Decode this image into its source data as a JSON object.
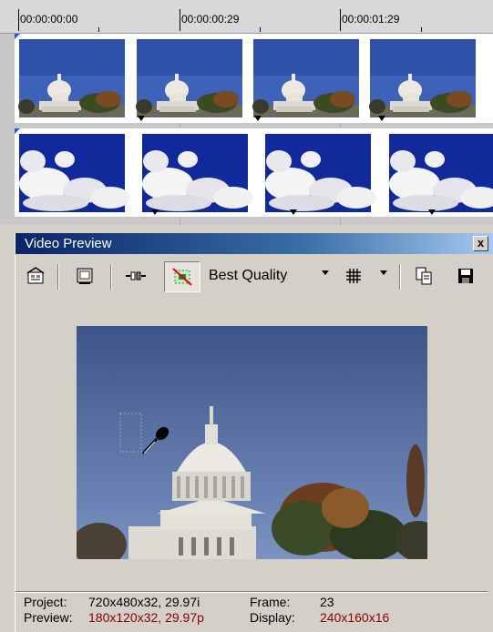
{
  "timeline": {
    "ruler_labels": [
      "00:00:00:00",
      "00:00:00:29",
      "00:00:01:29"
    ]
  },
  "video_preview": {
    "title": "Video Preview",
    "close_glyph": "x",
    "quality_label": "Best Quality",
    "icons": [
      "properties-icon",
      "preview-monitor-icon",
      "split-screen-icon",
      "overlays-icon",
      "grid-icon",
      "copy-snapshot-icon",
      "save-snapshot-icon",
      "eyedropper-icon"
    ]
  },
  "status": {
    "project_label": "Project:",
    "project_value": "720x480x32, 29.97i",
    "preview_label": "Preview:",
    "preview_value": "180x120x32, 29.97p",
    "frame_label": "Frame:",
    "frame_value": "23",
    "display_label": "Display:",
    "display_value": "240x160x16"
  },
  "colors": {
    "title_bar": "#0a246a",
    "stat_red": "#8b0000",
    "panel_bg": "#d4d0c8"
  }
}
